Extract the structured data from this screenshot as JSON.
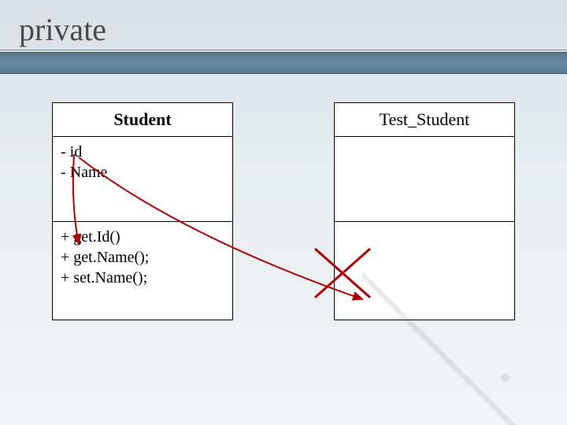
{
  "title": "private",
  "classes": {
    "student": {
      "name": "Student",
      "attributes": [
        "- id",
        "- Name"
      ],
      "operations": [
        "+ get.Id()",
        "+ get.Name();",
        "+ set.Name();"
      ]
    },
    "test": {
      "name": "Test_Student",
      "attributes": [],
      "operations": []
    }
  },
  "annotations": {
    "arrow_color": "#b30000",
    "cross_color": "#b30000"
  }
}
